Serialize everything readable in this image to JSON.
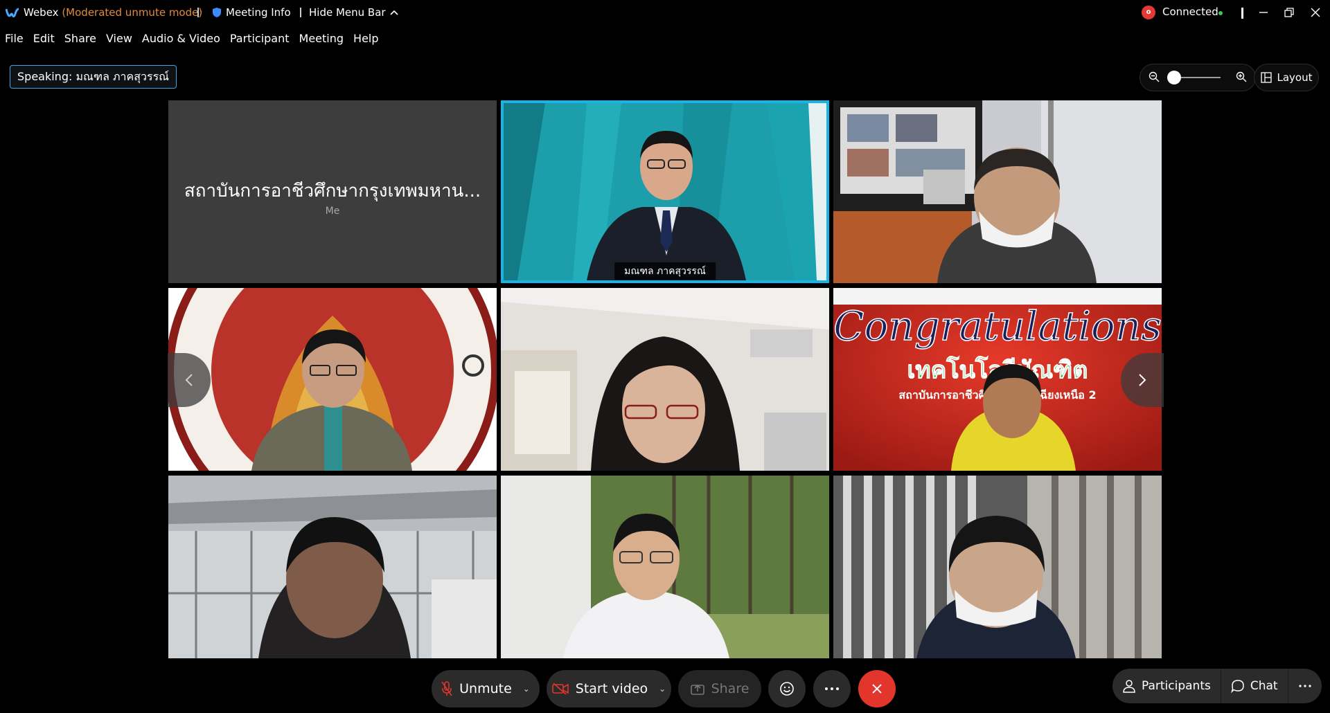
{
  "titlebar": {
    "app_name": "Webex",
    "mode": "(Moderated unmute mode)",
    "meeting_info": "Meeting Info",
    "hide_menu_bar": "Hide Menu Bar",
    "connection": "Connected"
  },
  "menu": [
    "File",
    "Edit",
    "Share",
    "View",
    "Audio & Video",
    "Participant",
    "Meeting",
    "Help"
  ],
  "speaking_label": "Speaking: มณฑล ภาคสุวรรณ์",
  "layout_label": "Layout",
  "tiles": {
    "me_name": "สถาบันการอาชีวศึกษากรุงเทพมหาน...",
    "me_subtitle": "Me",
    "active_speaker": "มณฑล ภาคสุวรรณ์",
    "banner_title": "Congratulations",
    "banner_line2": "เทคโนโลยีบัณฑิต",
    "banner_line3": "สถาบันการอาชีวศึกษ... ออกเฉียงเหนือ 2"
  },
  "controls": {
    "unmute": "Unmute",
    "start_video": "Start video",
    "share": "Share",
    "participants": "Participants",
    "chat": "Chat"
  },
  "colors": {
    "accent_border": "#19b3e6",
    "end_call": "#e2352b",
    "mode_text": "#e08a3c",
    "connected_dot": "#3ec55b",
    "record": "#e53935"
  }
}
